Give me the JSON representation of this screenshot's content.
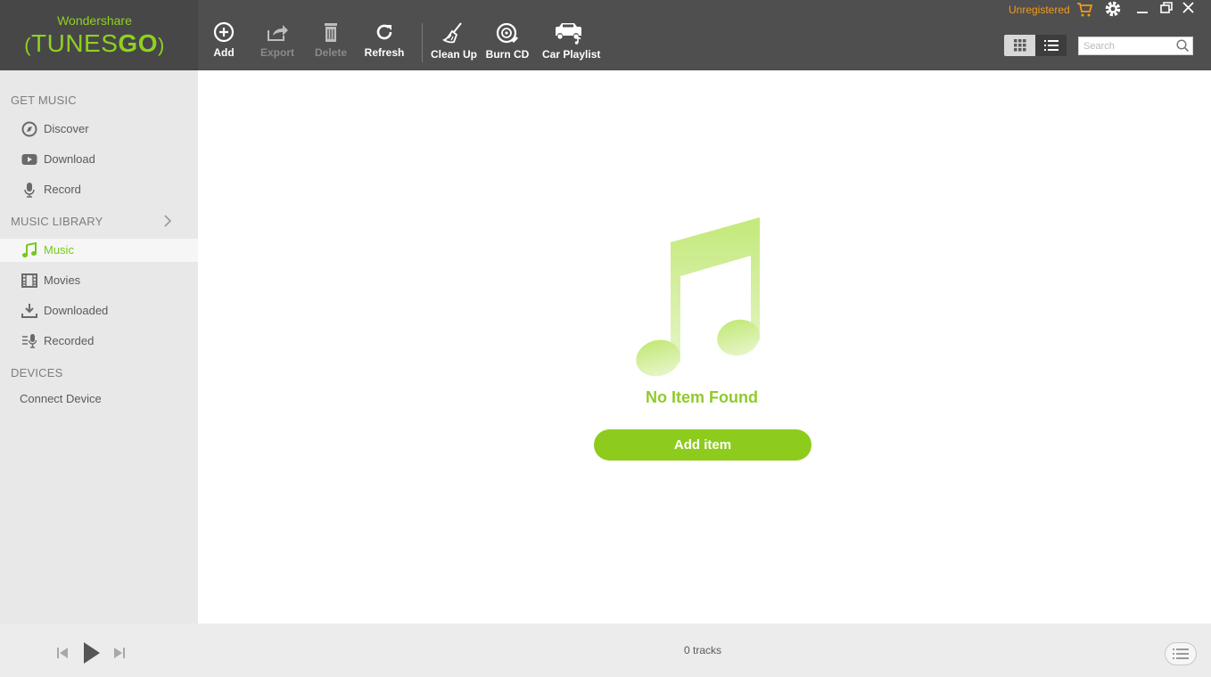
{
  "app": {
    "brand": "Wondershare",
    "product_light": "TUNES",
    "product_bold": "GO"
  },
  "toolbar": {
    "add": "Add",
    "export": "Export",
    "delete": "Delete",
    "refresh": "Refresh",
    "clean_up": "Clean Up",
    "burn_cd": "Burn CD",
    "car_playlist": "Car Playlist"
  },
  "topright": {
    "registration": "Unregistered",
    "search_placeholder": "Search",
    "view_mode": "grid"
  },
  "sidebar": {
    "get_music": {
      "heading": "GET MUSIC",
      "items": [
        {
          "label": "Discover",
          "icon": "compass-icon"
        },
        {
          "label": "Download",
          "icon": "youtube-icon"
        },
        {
          "label": "Record",
          "icon": "microphone-icon"
        }
      ]
    },
    "music_library": {
      "heading": "MUSIC LIBRARY",
      "items": [
        {
          "label": "Music",
          "icon": "music-note-icon",
          "active": true
        },
        {
          "label": "Movies",
          "icon": "film-icon"
        },
        {
          "label": "Downloaded",
          "icon": "download-icon"
        },
        {
          "label": "Recorded",
          "icon": "recorded-icon"
        }
      ]
    },
    "devices": {
      "heading": "DEVICES",
      "connect": "Connect Device"
    }
  },
  "main": {
    "empty_title": "No Item Found",
    "add_item": "Add item"
  },
  "player": {
    "track_count": "0 tracks"
  },
  "colors": {
    "accent": "#8dcc1d",
    "warning": "#f39b1a",
    "topbar": "#4f4f4f",
    "sidebar": "#e8e8e8"
  }
}
